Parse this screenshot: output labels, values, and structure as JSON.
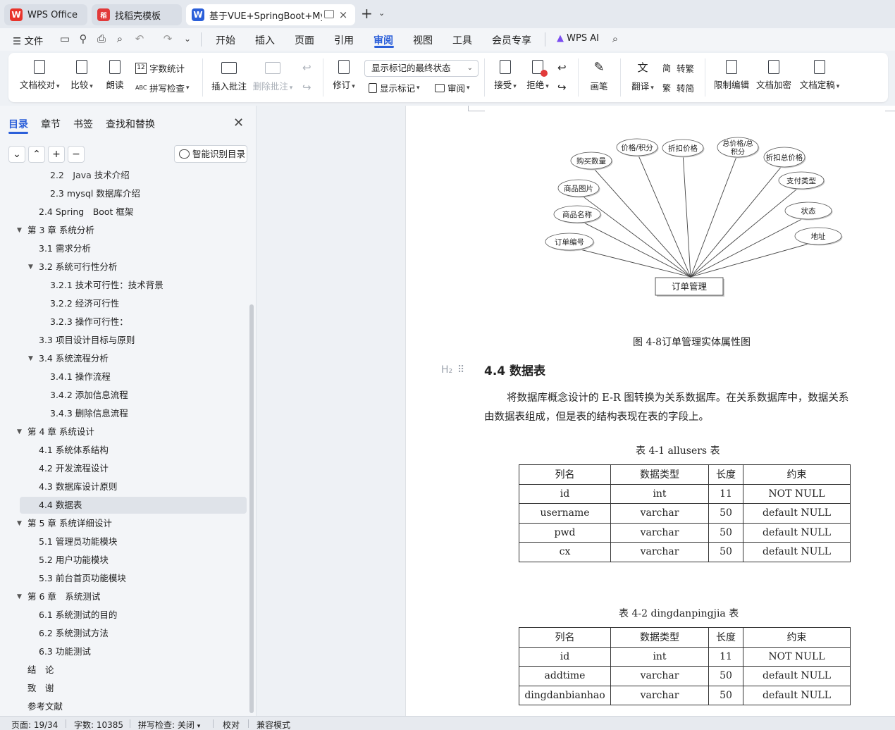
{
  "tabs": [
    {
      "label": "WPS Office",
      "logo": "W"
    },
    {
      "label": "找稻壳模板",
      "logo": "稻"
    },
    {
      "label": "基于VUE+SpringBoot+MySQ",
      "logo": "W"
    }
  ],
  "menu": {
    "file": "文件",
    "items": [
      "开始",
      "插入",
      "页面",
      "引用",
      "审阅",
      "视图",
      "工具",
      "会员专享"
    ],
    "active": "审阅",
    "ai": "WPS AI"
  },
  "ribbon": {
    "doc_check": "文档校对",
    "compare": "比较",
    "read_aloud": "朗读",
    "word_count": "字数统计",
    "spell_check": "拼写检查",
    "insert_comment": "插入批注",
    "delete_comment": "删除批注",
    "revise": "修订",
    "markup_select": "显示标记的最终状态",
    "show_markup": "显示标记",
    "review": "审阅",
    "accept": "接受",
    "reject": "拒绝",
    "pen": "画笔",
    "translate": "翻译",
    "to_traditional": "转繁",
    "to_simplified": "转简",
    "restrict_edit": "限制编辑",
    "encrypt": "文档加密",
    "finalize": "文档定稿"
  },
  "panel": {
    "tabs": [
      "目录",
      "章节",
      "书签",
      "查找和替换"
    ],
    "smart_toc": "智能识别目录",
    "toc": [
      {
        "text": "2.2　Java 技术介绍",
        "level": 3
      },
      {
        "text": "2.3 mysql 数据库介绍",
        "level": 3
      },
      {
        "text": "2.4 Spring　Boot 框架",
        "level": 2
      },
      {
        "text": "第 3 章  系统分析",
        "level": 1,
        "arrow": true
      },
      {
        "text": "3.1  需求分析",
        "level": 2
      },
      {
        "text": "3.2  系统可行性分析",
        "level": 2,
        "arrow": true
      },
      {
        "text": "3.2.1 技术可行性：技术背景",
        "level": 3
      },
      {
        "text": "3.2.2 经济可行性",
        "level": 3
      },
      {
        "text": "3.2.3 操作可行性：",
        "level": 3
      },
      {
        "text": "3.3  项目设计目标与原则",
        "level": 2
      },
      {
        "text": "3.4 系统流程分析",
        "level": 2,
        "arrow": true
      },
      {
        "text": "3.4.1 操作流程",
        "level": 3
      },
      {
        "text": "3.4.2 添加信息流程",
        "level": 3
      },
      {
        "text": "3.4.3 删除信息流程",
        "level": 3
      },
      {
        "text": "第 4 章  系统设计",
        "level": 1,
        "arrow": true
      },
      {
        "text": "4.1  系统体系结构",
        "level": 2
      },
      {
        "text": "4.2 开发流程设计",
        "level": 2
      },
      {
        "text": "4.3  数据库设计原则",
        "level": 2
      },
      {
        "text": "4.4  数据表",
        "level": 2,
        "selected": true
      },
      {
        "text": "第 5 章  系统详细设计",
        "level": 1,
        "arrow": true
      },
      {
        "text": "5.1 管理员功能模块",
        "level": 2
      },
      {
        "text": "5.2 用户功能模块",
        "level": 2
      },
      {
        "text": "5.3 前台首页功能模块",
        "level": 2
      },
      {
        "text": "第 6 章　系统测试",
        "level": 1,
        "arrow": true
      },
      {
        "text": "6.1 系统测试的目的",
        "level": 2
      },
      {
        "text": "6.2 系统测试方法",
        "level": 2
      },
      {
        "text": "6.3 功能测试",
        "level": 2
      },
      {
        "text": "结　论",
        "level": 1
      },
      {
        "text": "致　谢",
        "level": 1
      },
      {
        "text": "参考文献",
        "level": 1
      }
    ]
  },
  "document": {
    "diagram": {
      "center": "订单管理",
      "attributes": [
        "购买数量",
        "价格/积分",
        "折扣价格",
        "总价格/总积分",
        "折扣总价格",
        "支付类型",
        "商品图片",
        "商品名称",
        "订单编号",
        "状态",
        "地址"
      ]
    },
    "figure_caption": "图 4-8订单管理实体属性图",
    "heading_mark": "H₂",
    "heading": "4.4  数据表",
    "paragraph": [
      "将数据库概念设计的 E-R 图转换为关系数据库。在关系数据库中，数据关系",
      "由数据表组成，但是表的结构表现在表的字段上。"
    ],
    "table1": {
      "caption": "表 4-1 allusers 表",
      "header": [
        "列名",
        "数据类型",
        "长度",
        "约束"
      ],
      "rows": [
        [
          "id",
          "int",
          "11",
          "NOT NULL"
        ],
        [
          "username",
          "varchar",
          "50",
          "default NULL"
        ],
        [
          "pwd",
          "varchar",
          "50",
          "default NULL"
        ],
        [
          "cx",
          "varchar",
          "50",
          "default NULL"
        ]
      ]
    },
    "table2": {
      "caption": "表 4-2 dingdanpingjia 表",
      "header": [
        "列名",
        "数据类型",
        "长度",
        "约束"
      ],
      "rows": [
        [
          "id",
          "int",
          "11",
          "NOT NULL"
        ],
        [
          "addtime",
          "varchar",
          "50",
          "default NULL"
        ],
        [
          "dingdanbianhao",
          "varchar",
          "50",
          "default NULL"
        ]
      ]
    }
  },
  "status": {
    "page": "页面: 19/34",
    "words": "字数: 10385",
    "spell": "拼写检查: 关闭",
    "proof": "校对",
    "compat": "兼容模式"
  },
  "colors": {
    "accent": "#2b5fd9",
    "wps_red": "#e8342b",
    "docer_red": "#e23a3a",
    "writer_blue": "#2b5fd9"
  }
}
